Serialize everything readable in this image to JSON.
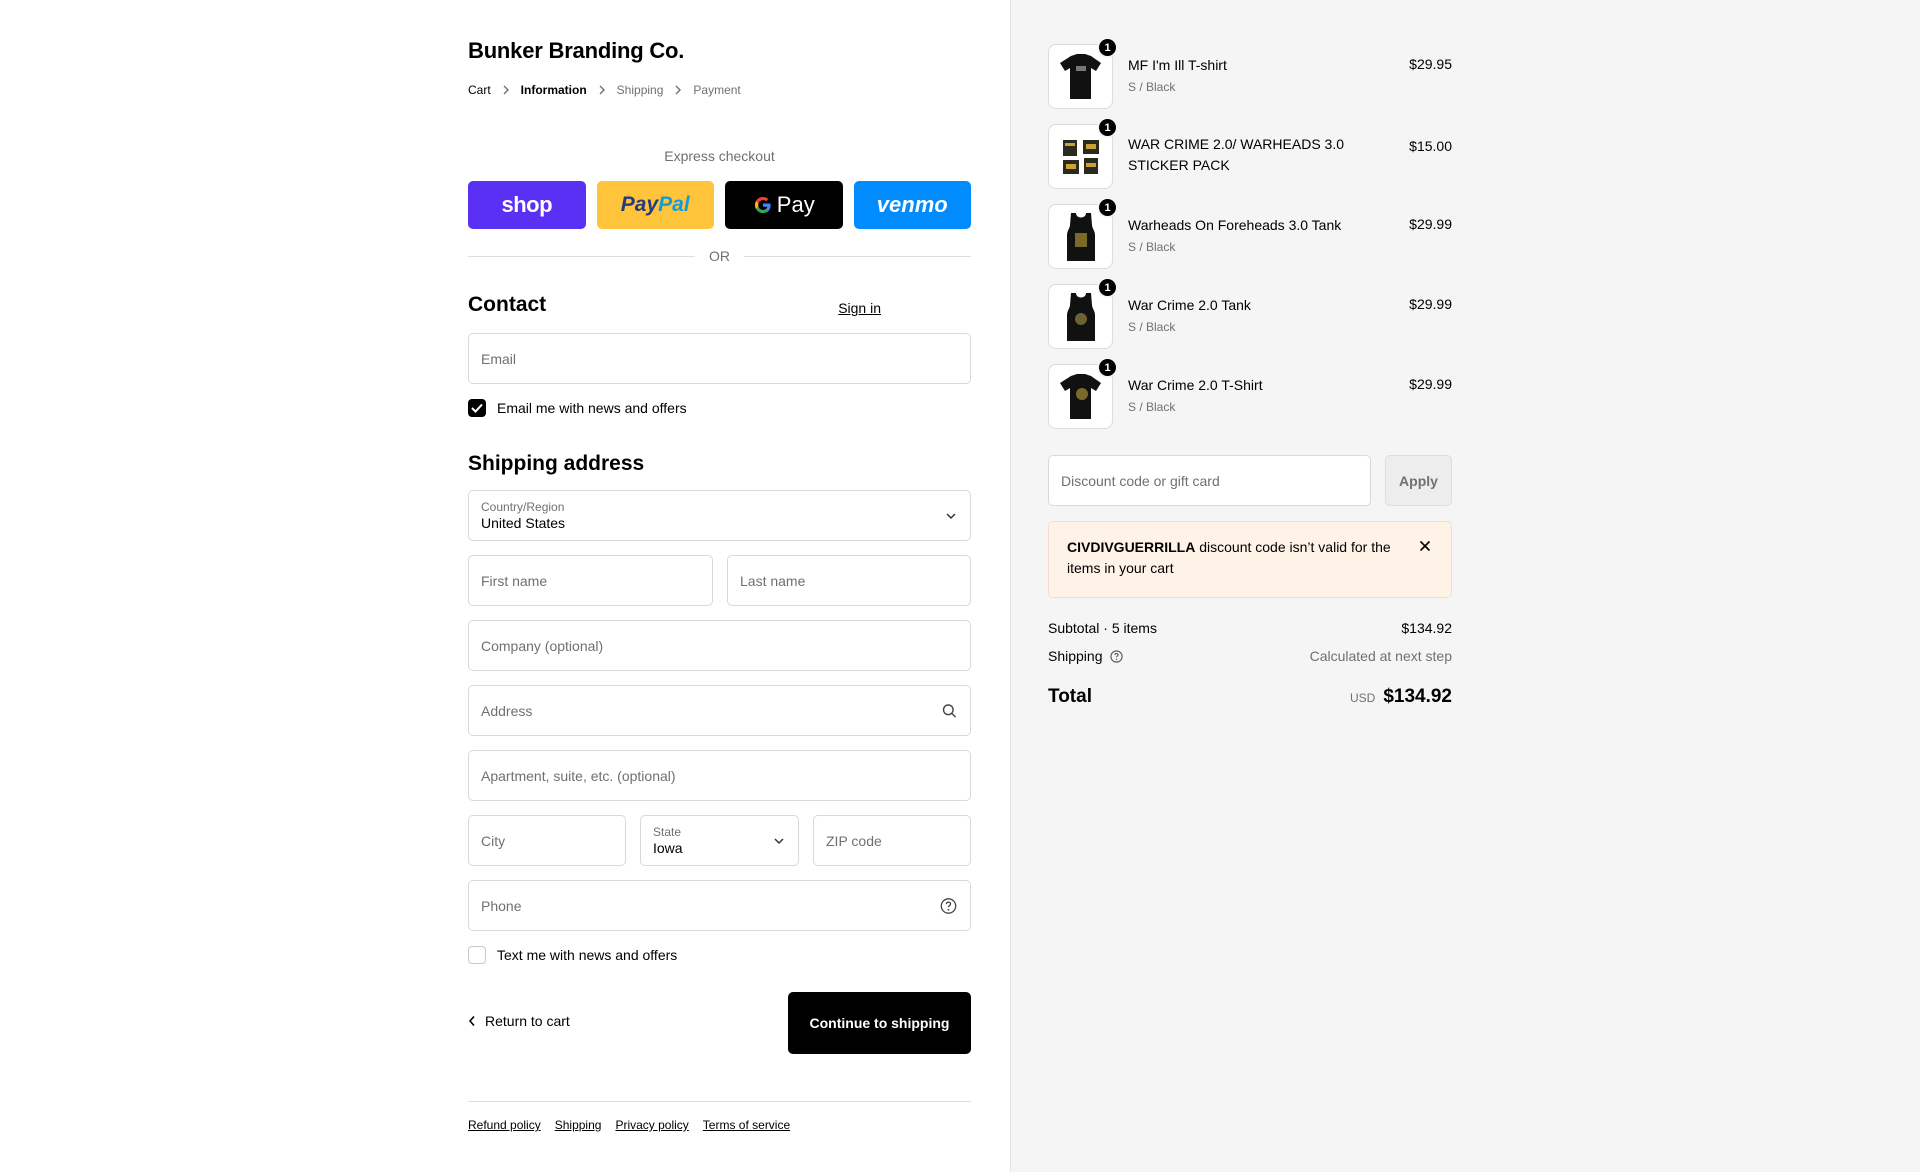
{
  "store": {
    "name": "Bunker Branding Co."
  },
  "breadcrumb": [
    {
      "label": "Cart",
      "state": "link"
    },
    {
      "label": "Information",
      "state": "active"
    },
    {
      "label": "Shipping",
      "state": "muted"
    },
    {
      "label": "Payment",
      "state": "muted"
    }
  ],
  "express": {
    "label": "Express checkout",
    "shop": "shop",
    "paypal_a": "Pay",
    "paypal_b": "Pal",
    "gpay": "Pay",
    "venmo": "venmo",
    "or": "OR"
  },
  "contact": {
    "heading": "Contact",
    "signin": "Sign in",
    "email_placeholder": "Email",
    "news_checkbox": "Email me with news and offers",
    "news_checked": true
  },
  "shipping": {
    "heading": "Shipping address",
    "country_label": "Country/Region",
    "country_value": "United States",
    "first_name": "First name",
    "last_name": "Last name",
    "company": "Company (optional)",
    "address": "Address",
    "apartment": "Apartment, suite, etc. (optional)",
    "city": "City",
    "state_label": "State",
    "state_value": "Iowa",
    "zip": "ZIP code",
    "phone": "Phone",
    "text_checkbox": "Text me with news and offers",
    "text_checked": false
  },
  "actions": {
    "return": "Return to cart",
    "continue": "Continue to shipping"
  },
  "footer": [
    "Refund policy",
    "Shipping",
    "Privacy policy",
    "Terms of service"
  ],
  "cart": {
    "items": [
      {
        "name": "MF I'm Ill T-shirt",
        "variant": "S / Black",
        "price": "$29.95",
        "qty": "1",
        "thumb": "tshirt"
      },
      {
        "name": "WAR CRIME 2.0/ WARHEADS 3.0 STICKER PACK",
        "variant": "",
        "price": "$15.00",
        "qty": "1",
        "thumb": "stickers"
      },
      {
        "name": "Warheads On Foreheads 3.0 Tank",
        "variant": "S / Black",
        "price": "$29.99",
        "qty": "1",
        "thumb": "tank"
      },
      {
        "name": "War Crime 2.0 Tank",
        "variant": "S / Black",
        "price": "$29.99",
        "qty": "1",
        "thumb": "tank"
      },
      {
        "name": "War Crime 2.0 T-Shirt",
        "variant": "S / Black",
        "price": "$29.99",
        "qty": "1",
        "thumb": "tshirt"
      }
    ],
    "discount_placeholder": "Discount code or gift card",
    "apply": "Apply",
    "error_code": "CIVDIVGUERRILLA",
    "error_message": " discount code isn’t valid for the items in your cart",
    "subtotal_label": "Subtotal · 5 items",
    "subtotal_value": "$134.92",
    "shipping_label": "Shipping",
    "shipping_value": "Calculated at next step",
    "total_label": "Total",
    "currency": "USD",
    "total_value": "$134.92"
  },
  "colors": {
    "shop": "#5a31f4",
    "paypal": "#ffc439",
    "gpay": "#000000",
    "venmo": "#008cff",
    "error_bg": "#fff3e8"
  }
}
